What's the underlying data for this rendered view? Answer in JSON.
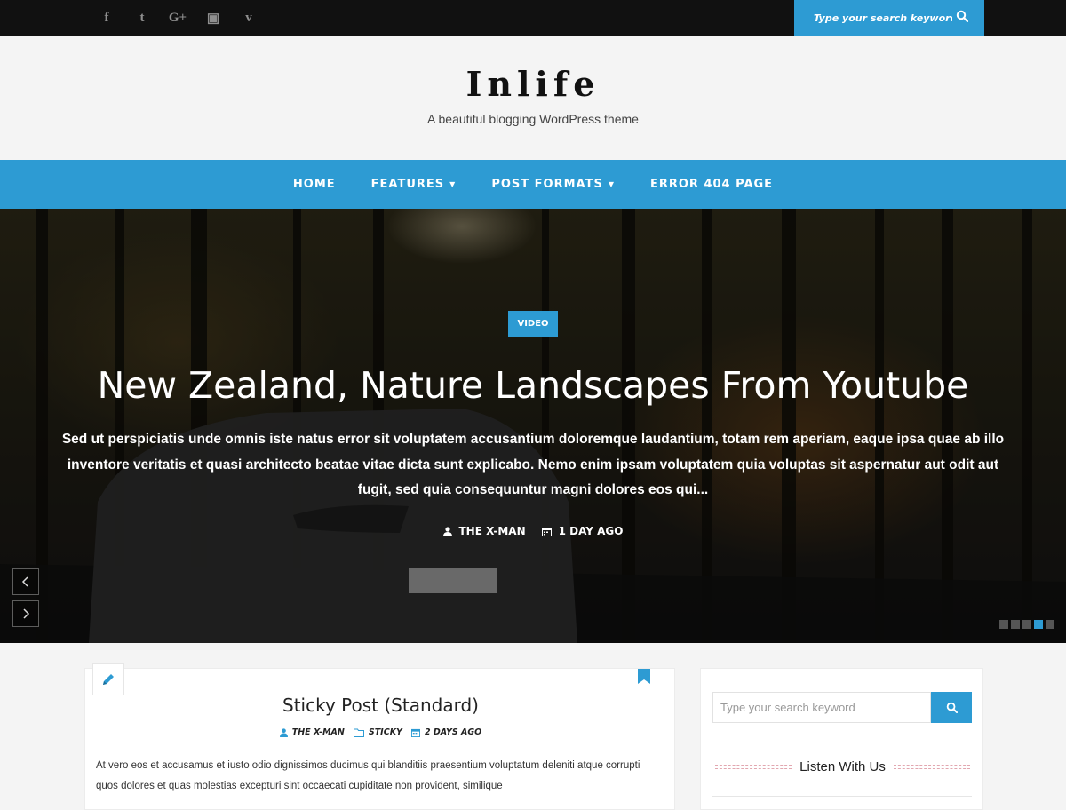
{
  "social": [
    {
      "name": "facebook-icon",
      "glyph": "f"
    },
    {
      "name": "twitter-icon",
      "glyph": "t"
    },
    {
      "name": "google-plus-icon",
      "glyph": "G+"
    },
    {
      "name": "youtube-icon",
      "glyph": "▣"
    },
    {
      "name": "vimeo-icon",
      "glyph": "v"
    }
  ],
  "top_search": {
    "placeholder": "Type your search keyword"
  },
  "header": {
    "title": "Inlife",
    "tagline": "A beautiful blogging WordPress theme"
  },
  "nav": {
    "home": "HOME",
    "features": "FEATURES",
    "post_formats": "POST FORMATS",
    "error": "ERROR 404 PAGE"
  },
  "hero": {
    "badge": "VIDEO",
    "title": "New Zealand, Nature Landscapes From Youtube",
    "excerpt": "Sed ut perspiciatis unde omnis iste natus error sit voluptatem accusantium doloremque laudantium, totam rem aperiam, eaque ipsa quae ab illo inventore veritatis et quasi architecto beatae vitae dicta sunt explicabo. Nemo enim ipsam voluptatem quia voluptas sit aspernatur aut odit aut fugit, sed quia consequuntur magni dolores eos qui...",
    "author": "THE X-MAN",
    "date": "1 DAY AGO"
  },
  "post": {
    "title": "Sticky Post (Standard)",
    "author": "THE X-MAN",
    "category": "STICKY",
    "date": "2 DAYS AGO",
    "excerpt": "At vero eos et accusamus et iusto odio dignissimos ducimus qui blanditiis praesentium voluptatum deleniti atque corrupti quos dolores et quas molestias excepturi sint occaecati cupiditate non provident, similique"
  },
  "sidebar": {
    "search_placeholder": "Type your search keyword",
    "widget_title": "Listen With Us"
  },
  "colors": {
    "accent": "#2d9bd3",
    "topbar": "#111111",
    "background": "#f4f4f4"
  }
}
